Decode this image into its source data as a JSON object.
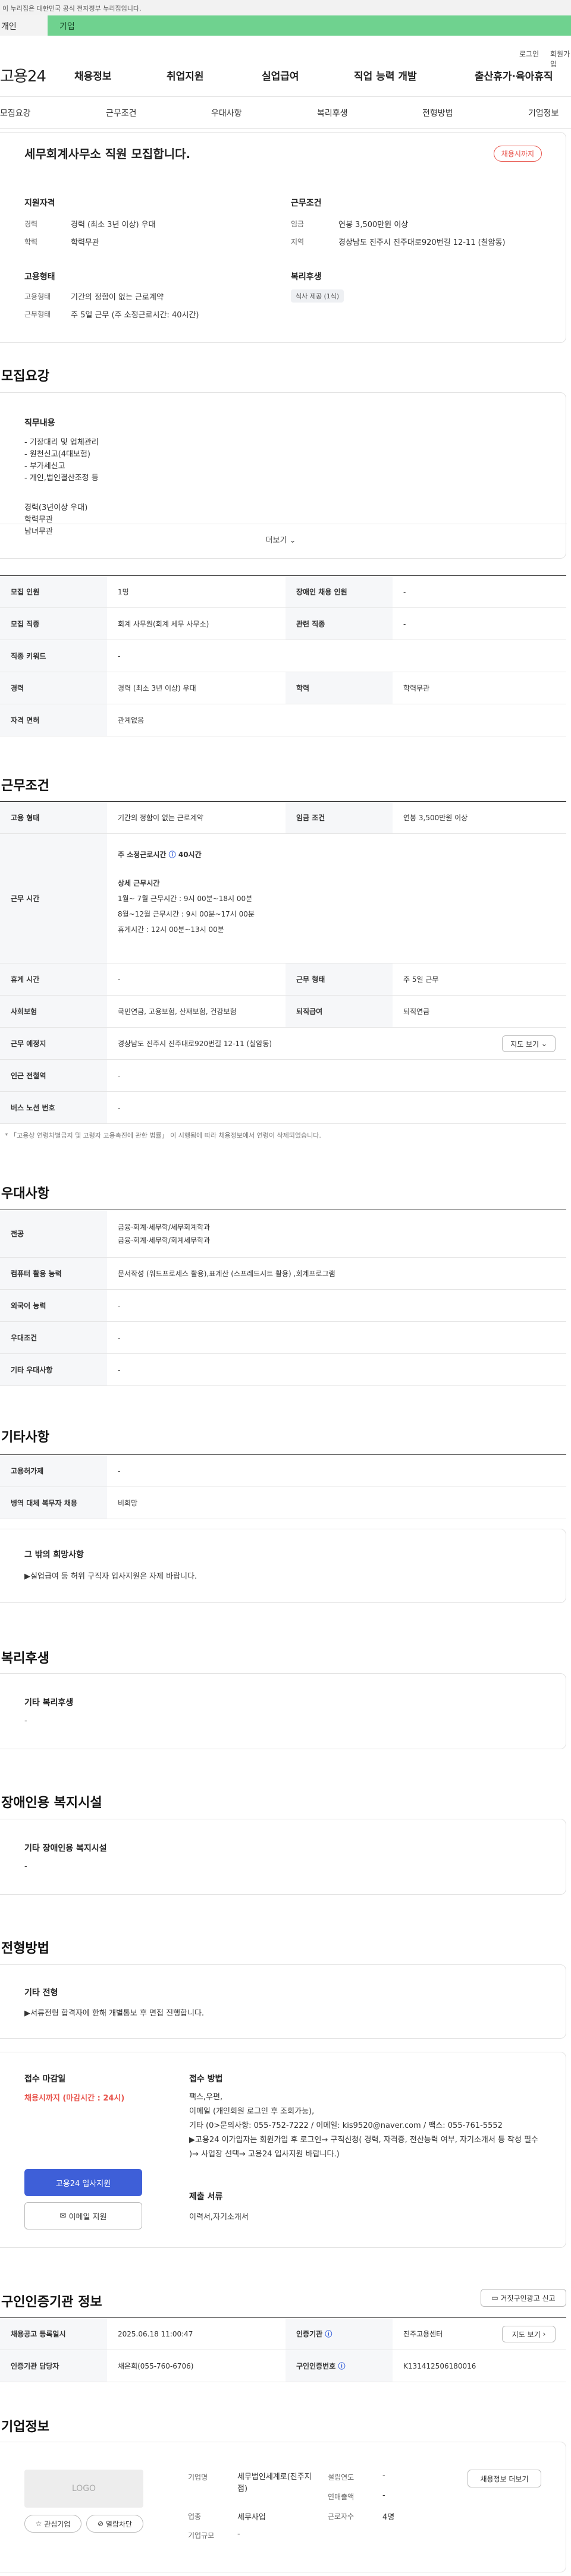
{
  "banner": "이 누리집은 대한민국 공식 전자정부 누리집입니다.",
  "user_tabs": {
    "personal": "개인",
    "company": "기업"
  },
  "utility": {
    "login": "로그인",
    "join": "회원가입"
  },
  "logo": "고용24",
  "gnb": [
    "채용정보",
    "취업지원",
    "실업급여",
    "직업 능력 개발",
    "출산휴가·육아휴직"
  ],
  "tabs": [
    "모집요강",
    "근무조건",
    "우대사항",
    "복리후생",
    "전형방법",
    "기업정보"
  ],
  "summary": {
    "title": "세무회계사무소 직원 모집합니다.",
    "badge": "채용시까지",
    "qual_title": "지원자격",
    "cond_title": "근무조건",
    "career_label": "경력",
    "career": "경력 (최소 3년 이상) 우대",
    "edu_label": "학력",
    "edu": "학력무관",
    "wage_label": "임금",
    "wage": "연봉 3,500만원 이상",
    "area_label": "지역",
    "area": "경상남도 진주시 진주대로920번길 12-11 (칠암동)",
    "emp_title": "고용형태",
    "welfare_title": "복리후생",
    "emp_label": "고용형태",
    "emp": "기간의 정함이 없는 근로계약",
    "hours_label": "근무형태",
    "hours": "주 5일 근무 (주 소정근로시간: 40시간)",
    "welfare_chip": "식사 제공 (1식)"
  },
  "recruit": {
    "section": "모집요강",
    "duty_title": "직무내용",
    "duty_lines": [
      "- 기장대리 및 업체관리",
      "- 원천신고(4대보험)",
      "- 부가세신고",
      "- 개인,법인결산조정 등"
    ],
    "duty_lines2": [
      "경력(3년이상 우대)",
      "학력무관",
      "남녀무관"
    ],
    "more": "더보기"
  },
  "recruit_table": [
    {
      "h1": "모집 인원",
      "v1": "1명",
      "h2": "장애인 채용 인원",
      "v2": "-"
    },
    {
      "h1": "모집 직종",
      "v1": "회계 사무원(회계 세무 사무소)",
      "h2": "관련 직종",
      "v2": "-"
    },
    {
      "h1": "직종 키워드",
      "v1": "-"
    },
    {
      "h1": "경력",
      "v1": "경력 (최소 3년 이상) 우대",
      "h2": "학력",
      "v2": "학력무관"
    },
    {
      "h1": "자격 면허",
      "v1": "관계없음"
    }
  ],
  "work": {
    "section": "근무조건",
    "emp_h": "고용 형태",
    "emp_v": "기간의 정함이 없는 근로계약",
    "wage_h": "임금 조건",
    "wage_v": "연봉 3,500만원 이상",
    "time_h": "근무 시간",
    "time_total": "주 소정근로시간",
    "time_total_v": "40시간",
    "time_detail_title": "상세 근무시간",
    "time_lines": [
      "1월~ 7월 근무시간 : 9시 00분~18시 00분",
      "8월~12월 근무시간 : 9시 00분~17시 00분",
      "휴게시간 : 12시 00분~13시 00분"
    ],
    "rest_h": "휴게 시간",
    "rest_v": "-",
    "form_h": "근무 형태",
    "form_v": "주 5일 근무",
    "ins_h": "사회보험",
    "ins_v": "국민연금, 고용보험, 산재보험, 건강보험",
    "ret_h": "퇴직급여",
    "ret_v": "퇴직연금",
    "place_h": "근무 예정지",
    "place_v": "경상남도 진주시 진주대로920번길 12-11 (칠암동)",
    "map_btn": "지도 보기",
    "sub_h": "인근 전철역",
    "sub_v": "-",
    "bus_h": "버스 노선 번호",
    "bus_v": "-",
    "note": "* 「고용상 연령차별금지 및 고령자 고용촉진에 관한 법률」 이 시행됨에 따라 채용정보에서 연령이 삭제되었습니다."
  },
  "prefer": {
    "section": "우대사항",
    "rows": [
      {
        "h": "전공",
        "v": "금융·회계·세무학/세무회계학과\n금융·회계·세무학/회계세무학과"
      },
      {
        "h": "컴퓨터 활용 능력",
        "v": "문서작성 (워드프로세스 활용),표계산 (스프레드시트 활용) ,회계프로그램"
      },
      {
        "h": "외국어 능력",
        "v": "-"
      },
      {
        "h": "우대조건",
        "v": "-"
      },
      {
        "h": "기타 우대사항",
        "v": "-"
      }
    ]
  },
  "etc": {
    "section": "기타사항",
    "rows": [
      {
        "h": "고용허가제",
        "v": "-"
      },
      {
        "h": "병역 대체 복무자 채용",
        "v": "비희망"
      }
    ],
    "hope_title": "그 밖의 희망사항",
    "hope_v": "▶실업급여 등 허위 구직자 입사지원은 자제 바랍니다."
  },
  "welfare": {
    "section": "복리후생",
    "title": "기타 복리후생",
    "v": "-"
  },
  "disabled": {
    "section": "장애인용 복지시설",
    "title": "기타 장애인용 복지시설",
    "v": "-"
  },
  "selection": {
    "section": "전형방법",
    "other_title": "기타 전형",
    "other_v": "▶서류전형 합격자에 한해 개별통보 후 면접 진행합니다.",
    "deadline_title": "접수 마감일",
    "deadline_v": "채용시까지 (마감시간 : 24시)",
    "apply_btn": "고용24 입사지원",
    "email_btn": "이메일 지원",
    "method_title": "접수 방법",
    "method_lines": [
      "팩스,우편,",
      "이메일 (개인회원 로그인 후 조회가능),",
      "기타 (0>문의사항: 055-752-7222 / 이메일: kis9520@naver.com / 팩스: 055-761-5552",
      "▶고용24 이가입자는 회원가입 후 로그인→ 구직신청( 경력, 자격증, 전산능력 여부, 자기소개서 등 작성 필수 )→ 사업장 선택→ 고용24 입사지원 바랍니다.)"
    ],
    "docs_title": "제출 서류",
    "docs_v": "이력서,자기소개서"
  },
  "agency": {
    "section": "구인인증기관 정보",
    "report_btn": "거짓구인광고 신고",
    "reg_h": "채용공고 등록일시",
    "reg_v": "2025.06.18 11:00:47",
    "org_h": "인증기관",
    "org_v": "진주고용센터",
    "map_btn": "지도 보기",
    "mgr_h": "인증기관 담당자",
    "mgr_v": "채은희(055-760-6706)",
    "num_h": "구인인증번호",
    "num_v": "K131412506180016"
  },
  "company": {
    "section": "기업정보",
    "logo": "LOGO",
    "fav_btn": "관심기업",
    "block_btn": "열람차단",
    "name_h": "기업명",
    "name_v": "세무법인세계로(진주지점)",
    "ind_h": "업종",
    "ind_v": "세무사업",
    "size_h": "기업규모",
    "size_v": "-",
    "year_h": "설립연도",
    "year_v": "-",
    "sales_h": "연매출액",
    "sales_v": "-",
    "emp_h": "근로자수",
    "emp_v": "4명",
    "more_btn": "채용정보 더보기"
  },
  "colors": {
    "accent": "#2b57d8",
    "green": "#6fd28f",
    "red": "#e8524a"
  }
}
